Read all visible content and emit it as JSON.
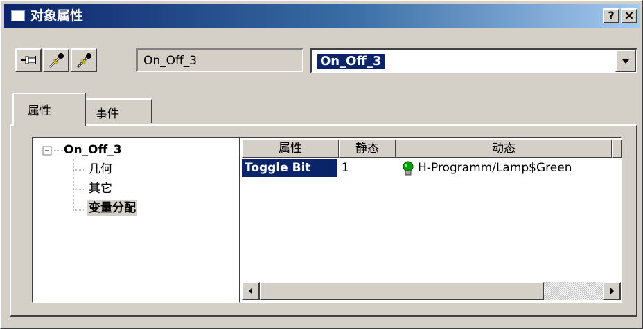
{
  "window": {
    "title": "对象属性",
    "help_label": "?",
    "close_label": "×"
  },
  "toolbar": {
    "pin_icon": "pin-icon",
    "pipette1_icon": "pipette-icon",
    "pipette2_icon": "pipette-icon",
    "object_name": "On_Off_3",
    "object_select_value": "On_Off_3"
  },
  "tabs": [
    {
      "label": "属性"
    },
    {
      "label": "事件"
    }
  ],
  "tree": {
    "root": "On_Off_3",
    "items": [
      {
        "label": "几何"
      },
      {
        "label": "其它"
      },
      {
        "label": "变量分配"
      }
    ]
  },
  "grid": {
    "columns": [
      "属性",
      "静态",
      "动态"
    ],
    "rows": [
      {
        "property": "Toggle Bit",
        "static": "1",
        "dynamic": "H-Programm/Lamp$Green"
      }
    ]
  },
  "colors": {
    "title_start": "#0a246a",
    "title_end": "#a6caf0",
    "selection": "#0a246a",
    "face": "#d4d0c8",
    "bulb": "#00a000"
  }
}
